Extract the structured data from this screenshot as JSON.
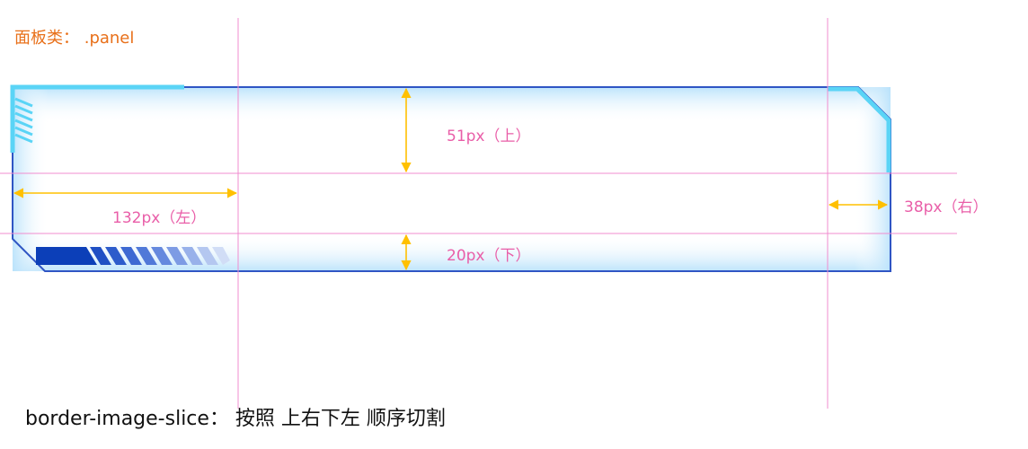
{
  "title": "面板类： .panel",
  "labels": {
    "top": "51px（上）",
    "left": "132px（左）",
    "right": "38px（右）",
    "bottom": "20px（下）"
  },
  "note": "border-image-slice：  按照 上右下左 顺序切割",
  "colors": {
    "title": "#e8701a",
    "guide": "#f08ccf",
    "arrow": "#ffc000",
    "label": "#e95ea8",
    "panel_border": "#2f55c4",
    "panel_accent": "#5ad4f6",
    "panel_dark": "#0c3fb8"
  }
}
